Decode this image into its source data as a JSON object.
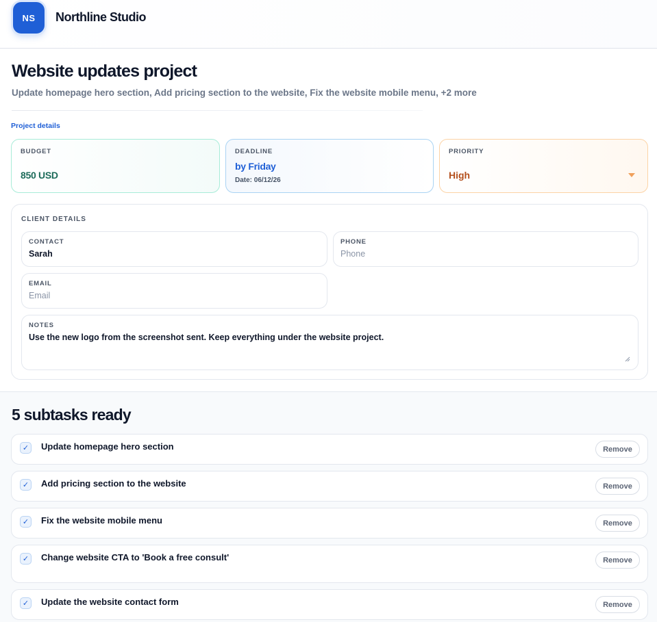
{
  "app": {
    "logo_initials": "NS",
    "studio_name": "Northline Studio"
  },
  "project": {
    "title": "Website updates project",
    "summary": "Update homepage hero section, Add pricing section to the website, Fix the website mobile menu, +2 more",
    "details_link": "Project details",
    "budget": {
      "label": "BUDGET",
      "value": "850 USD"
    },
    "deadline": {
      "label": "DEADLINE",
      "value": "by Friday",
      "date": "Date: 06/12/26"
    },
    "priority": {
      "label": "PRIORITY",
      "value": "High"
    }
  },
  "client": {
    "heading": "CLIENT DETAILS",
    "contact": {
      "label": "CONTACT",
      "value": "Sarah"
    },
    "phone": {
      "label": "PHONE",
      "placeholder": "Phone"
    },
    "email": {
      "label": "EMAIL",
      "placeholder": "Email"
    },
    "notes": {
      "label": "NOTES",
      "value": "Use the new logo from the screenshot sent. Keep everything under the website project."
    }
  },
  "subtasks": {
    "title": "5 subtasks ready",
    "check_glyph": "✓",
    "remove_label": "Remove",
    "items": [
      {
        "label": "Update homepage hero section"
      },
      {
        "label": "Add pricing section to the website"
      },
      {
        "label": "Fix the website mobile menu"
      },
      {
        "label": "Change website CTA to 'Book a free consult'"
      },
      {
        "label": "Update the website contact form"
      }
    ]
  },
  "colors": {
    "accent": "#1f5fd6",
    "budget": "#1d6b5a",
    "priority": "#b4501d"
  }
}
